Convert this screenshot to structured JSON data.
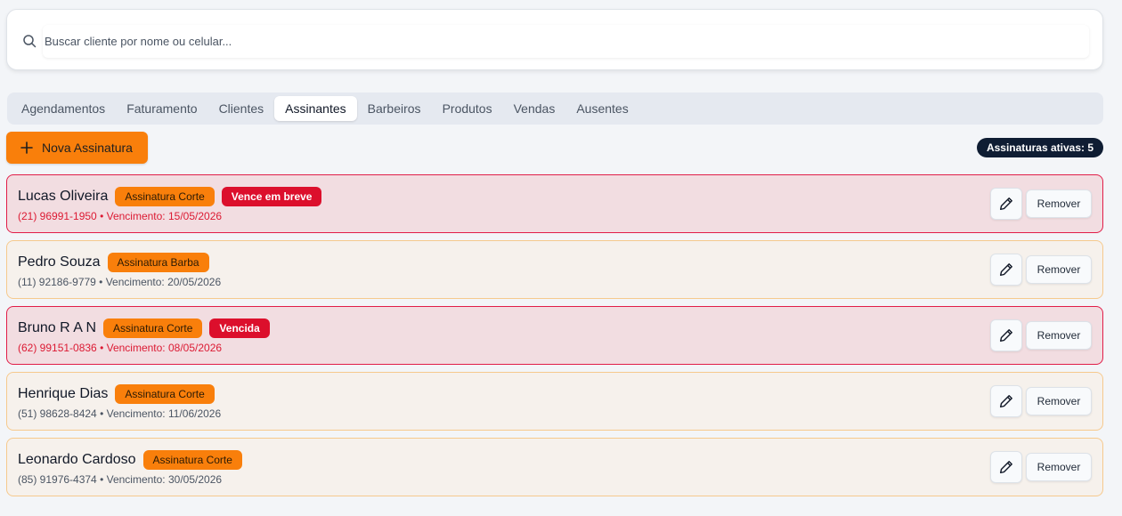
{
  "search": {
    "placeholder": "Buscar cliente por nome ou celular...",
    "icon": "search-icon"
  },
  "tabs": [
    {
      "label": "Agendamentos",
      "active": false
    },
    {
      "label": "Faturamento",
      "active": false
    },
    {
      "label": "Clientes",
      "active": false
    },
    {
      "label": "Assinantes",
      "active": true
    },
    {
      "label": "Barbeiros",
      "active": false
    },
    {
      "label": "Produtos",
      "active": false
    },
    {
      "label": "Vendas",
      "active": false
    },
    {
      "label": "Ausentes",
      "active": false
    }
  ],
  "toolbar": {
    "new_label": "Nova Assinatura",
    "active_count_label": "Assinaturas ativas: 5"
  },
  "subscribers": [
    {
      "name": "Lucas Oliveira",
      "plan": "Assinatura Corte",
      "status": "Vence em breve",
      "alert": true,
      "meta": "(21) 96991-1950 • Vencimento: 15/05/2026"
    },
    {
      "name": "Pedro Souza",
      "plan": "Assinatura Barba",
      "status": "",
      "alert": false,
      "meta": "(11) 92186-9779 • Vencimento: 20/05/2026"
    },
    {
      "name": "Bruno R A N",
      "plan": "Assinatura Corte",
      "status": "Vencida",
      "alert": true,
      "meta": "(62) 99151-0836 • Vencimento: 08/05/2026"
    },
    {
      "name": "Henrique Dias",
      "plan": "Assinatura Corte",
      "status": "",
      "alert": false,
      "meta": "(51) 98628-8424 • Vencimento: 11/06/2026"
    },
    {
      "name": "Leonardo Cardoso",
      "plan": "Assinatura Corte",
      "status": "",
      "alert": false,
      "meta": "(85) 91976-4374 • Vencimento: 30/05/2026"
    }
  ],
  "actions": {
    "remove_label": "Remover",
    "edit_icon": "pencil-icon"
  },
  "colors": {
    "accent": "#f97f0b",
    "danger": "#dc0f2c",
    "badge_dark": "#0f1d33",
    "row_alert_bg": "#f2dde1",
    "row_normal_bg": "#f6f1ec"
  }
}
